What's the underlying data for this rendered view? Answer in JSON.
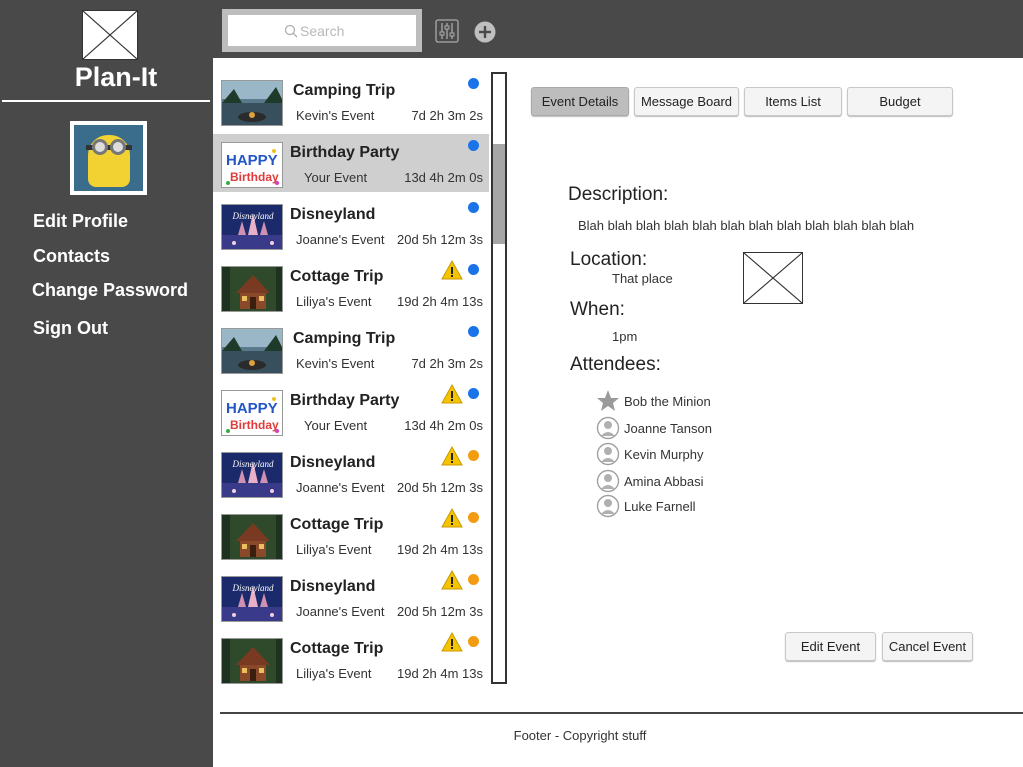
{
  "app": {
    "title": "Plan-It"
  },
  "sidebar": {
    "items": [
      {
        "label": "Edit Profile"
      },
      {
        "label": "Contacts"
      },
      {
        "label": "Change Password"
      },
      {
        "label": "Sign Out"
      }
    ]
  },
  "topbar": {
    "search_placeholder": "Search",
    "filter_icon": "sliders-icon",
    "add_icon": "plus-circle-icon"
  },
  "events": [
    {
      "title": "Camping Trip",
      "owner": "Kevin's Event",
      "countdown": "7d 2h 3m 2s",
      "status_color": "#1a73e8",
      "warning": false,
      "thumb": "camping"
    },
    {
      "title": "Birthday Party",
      "owner": "Your Event",
      "countdown": "13d 4h 2m 0s",
      "status_color": "#1a73e8",
      "warning": false,
      "thumb": "birthday",
      "selected": true
    },
    {
      "title": "Disneyland",
      "owner": "Joanne's Event",
      "countdown": "20d 5h 12m 3s",
      "status_color": "#1a73e8",
      "warning": false,
      "thumb": "disney"
    },
    {
      "title": "Cottage Trip",
      "owner": "Liliya's Event",
      "countdown": "19d 2h 4m 13s",
      "status_color": "#1a73e8",
      "warning": true,
      "thumb": "cottage"
    },
    {
      "title": "Camping Trip",
      "owner": "Kevin's Event",
      "countdown": "7d 2h 3m 2s",
      "status_color": "#1a73e8",
      "warning": false,
      "thumb": "camping"
    },
    {
      "title": "Birthday Party",
      "owner": "Your Event",
      "countdown": "13d 4h 2m 0s",
      "status_color": "#1a73e8",
      "warning": true,
      "thumb": "birthday"
    },
    {
      "title": "Disneyland",
      "owner": "Joanne's Event",
      "countdown": "20d 5h 12m 3s",
      "status_color": "#f39c12",
      "warning": true,
      "thumb": "disney"
    },
    {
      "title": "Cottage Trip",
      "owner": "Liliya's Event",
      "countdown": "19d 2h 4m 13s",
      "status_color": "#f39c12",
      "warning": true,
      "thumb": "cottage"
    },
    {
      "title": "Disneyland",
      "owner": "Joanne's Event",
      "countdown": "20d 5h 12m 3s",
      "status_color": "#f39c12",
      "warning": true,
      "thumb": "disney"
    },
    {
      "title": "Cottage Trip",
      "owner": "Liliya's Event",
      "countdown": "19d 2h 4m 13s",
      "status_color": "#f39c12",
      "warning": true,
      "thumb": "cottage"
    }
  ],
  "tabs": [
    {
      "label": "Event Details",
      "active": true
    },
    {
      "label": "Message Board"
    },
    {
      "label": "Items List"
    },
    {
      "label": "Budget"
    }
  ],
  "details": {
    "description_heading": "Description:",
    "description": "Blah blah blah blah blah blah blah blah blah blah blah blah",
    "location_heading": "Location:",
    "location": "That place",
    "when_heading": "When:",
    "when": "1pm",
    "attendees_heading": "Attendees:",
    "attendees": [
      {
        "name": "Bob the Minion",
        "icon": "star-icon"
      },
      {
        "name": "Joanne Tanson",
        "icon": "person-icon"
      },
      {
        "name": "Kevin Murphy",
        "icon": "person-icon"
      },
      {
        "name": "Amina Abbasi",
        "icon": "person-icon"
      },
      {
        "name": "Luke Farnell",
        "icon": "person-icon"
      }
    ]
  },
  "actions": {
    "edit": "Edit Event",
    "cancel": "Cancel Event"
  },
  "footer": {
    "text": "Footer - Copyright stuff"
  }
}
